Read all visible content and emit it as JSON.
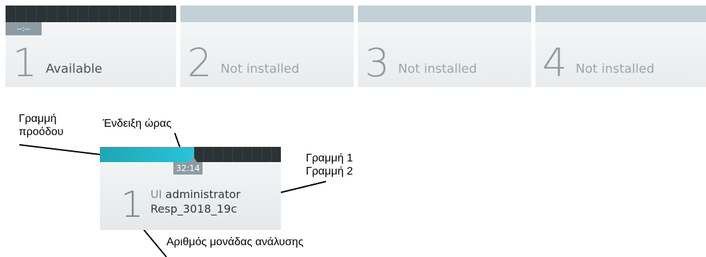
{
  "modules": [
    {
      "number": "1",
      "status": "Available",
      "time": "--:--",
      "active": true
    },
    {
      "number": "2",
      "status": "Not installed",
      "active": false
    },
    {
      "number": "3",
      "status": "Not installed",
      "active": false
    },
    {
      "number": "4",
      "status": "Not installed",
      "active": false
    }
  ],
  "callouts": {
    "progress_bar": [
      "Γραμμή",
      "προόδου"
    ],
    "time_display": "Ένδειξη ώρας",
    "line1": "Γραμμή 1",
    "line2": "Γραμμή 2",
    "module_number": "Αριθμός μονάδας ανάλυσης"
  },
  "detail_tile": {
    "number": "1",
    "line1_prefix": "UI",
    "line1_rest": "administrator",
    "line2": "Resp_3018_19c",
    "time": "32:14",
    "progress": 0.52
  }
}
